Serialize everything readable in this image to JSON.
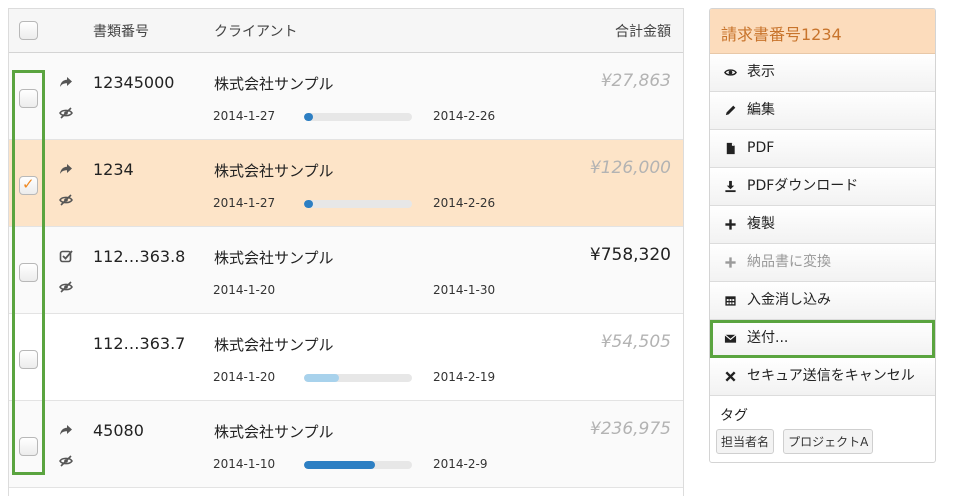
{
  "table": {
    "headers": {
      "doc_no": "書類番号",
      "client": "クライアント",
      "total": "合計金額"
    },
    "rows": [
      {
        "doc_no": "12345000",
        "client": "株式会社サンプル",
        "start": "2014-1-27",
        "end": "2014-2-26",
        "progress": 0.08,
        "amount": "¥27,863",
        "checked": false,
        "top_icon": "share-icon",
        "bottom_icon": "eye-slash-icon"
      },
      {
        "doc_no": "1234",
        "client": "株式会社サンプル",
        "start": "2014-1-27",
        "end": "2014-2-26",
        "progress": 0.08,
        "amount": "¥126,000",
        "checked": true,
        "top_icon": "share-icon",
        "bottom_icon": "eye-slash-icon"
      },
      {
        "doc_no": "112…363.8",
        "client": "株式会社サンプル",
        "start": "2014-1-20",
        "end": "2014-1-30",
        "progress": 0,
        "amount": "¥758,320",
        "checked": false,
        "top_icon": "check-square-icon",
        "bottom_icon": "eye-slash-icon"
      },
      {
        "doc_no": "112…363.7",
        "client": "株式会社サンプル",
        "start": "2014-1-20",
        "end": "2014-2-19",
        "progress": 0.32,
        "amount": "¥54,505",
        "checked": false,
        "top_icon": "",
        "bottom_icon": ""
      },
      {
        "doc_no": "45080",
        "client": "株式会社サンプル",
        "start": "2014-1-10",
        "end": "2014-2-9",
        "progress": 0.66,
        "amount": "¥236,975",
        "checked": false,
        "top_icon": "share-icon",
        "bottom_icon": "eye-slash-icon"
      }
    ]
  },
  "panel": {
    "title": "請求書番号1234",
    "actions": [
      {
        "label": "表示",
        "icon": "eye-icon"
      },
      {
        "label": "編集",
        "icon": "pencil-icon"
      },
      {
        "label": "PDF",
        "icon": "file-icon"
      },
      {
        "label": "PDFダウンロード",
        "icon": "download-icon"
      },
      {
        "label": "複製",
        "icon": "plus-icon"
      },
      {
        "label": "納品書に変換",
        "icon": "plus-icon"
      },
      {
        "label": "入金消し込み",
        "icon": "calendar-icon"
      },
      {
        "label": "送付...",
        "icon": "envelope-icon"
      },
      {
        "label": "セキュア送信をキャンセル",
        "icon": "close-icon"
      }
    ],
    "tags_label": "タグ",
    "tags": [
      "担当者名",
      "プロジェクトA"
    ]
  },
  "colors": {
    "selected_row": "#fde4c8",
    "panel_header": "#fcdcbc",
    "panel_title_text": "#c8742c",
    "highlight_green": "#5aa43f",
    "progress_blue": "#2d7fc3",
    "progress_light": "#a8d2ec"
  }
}
